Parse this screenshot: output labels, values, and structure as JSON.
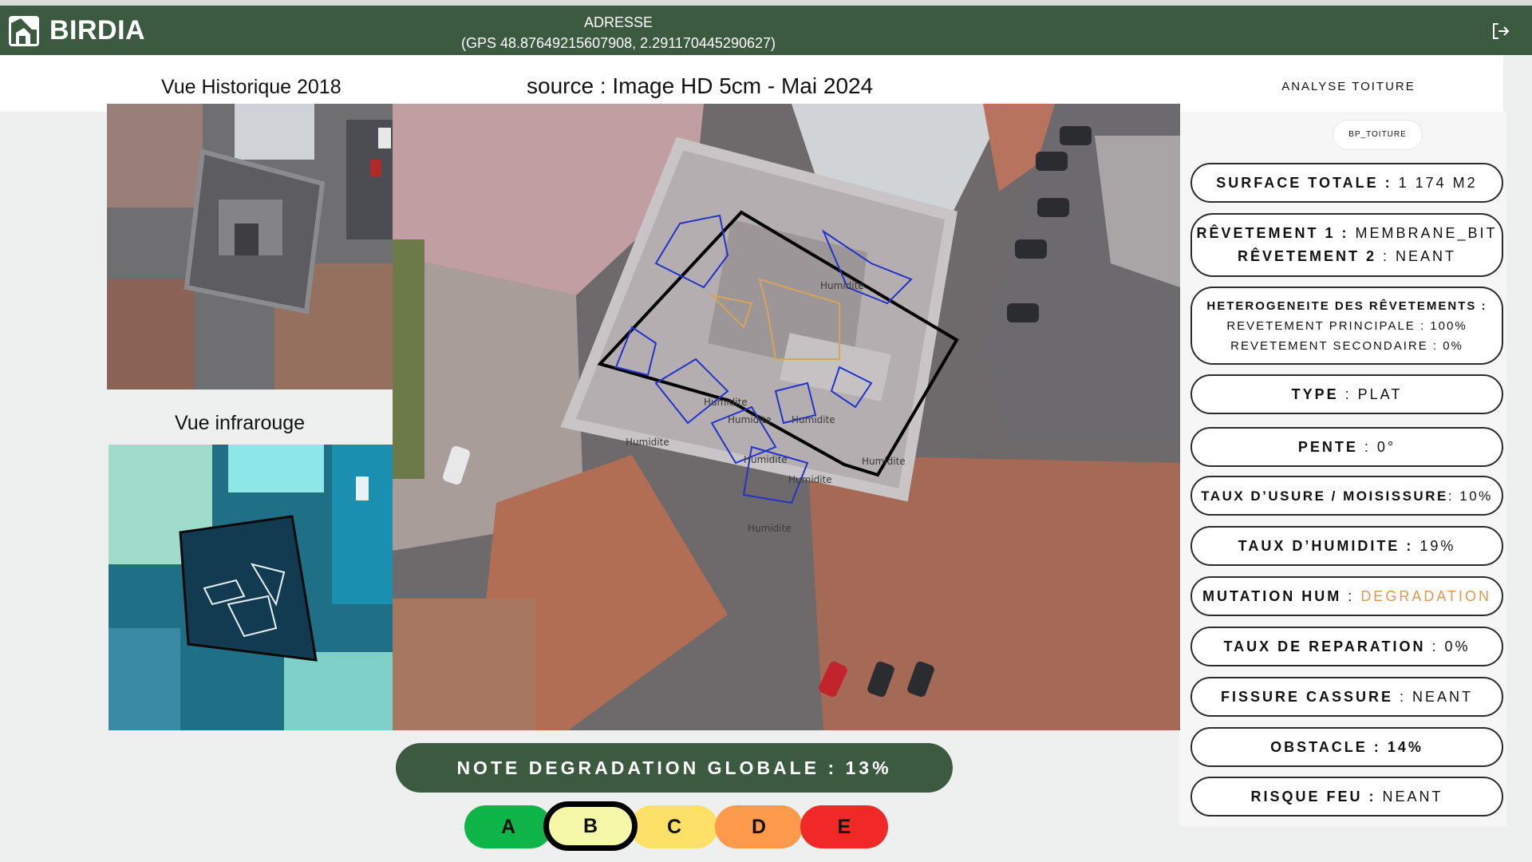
{
  "header": {
    "brand": "BIRDIA",
    "address_label": "ADRESSE",
    "gps": "(GPS 48.87649215607908, 2.291170445290627)",
    "logout_icon": "logout-icon"
  },
  "views": {
    "historic_title": "Vue Historique 2018",
    "infrared_title": "Vue infrarouge",
    "source_title": "source : Image HD 5cm - Mai 2024"
  },
  "map_labels": [
    "Humidite",
    "Humidite",
    "Humidite",
    "Humidite",
    "Humidite",
    "Humidite",
    "Humidite",
    "Humidite",
    "Humidite"
  ],
  "analysis": {
    "title": "ANALYSE TOITURE",
    "chip": "BP_TOITURE",
    "items": [
      {
        "key": "SURFACE TOTALE :",
        "value": " 1 174 M2"
      },
      {
        "key1": "RÊVETEMENT 1 :",
        "value1": " MEMBRANE_BIT",
        "key2": "RÊVETEMENT 2",
        "value2": " : NEANT"
      },
      {
        "key": "HETEROGENEITE DES RÊVETEMENTS :",
        "line2": "REVETEMENT PRINCIPALE : 100%",
        "line3": "REVETEMENT SECONDAIRE : 0%"
      },
      {
        "key": "TYPE",
        "value": " : PLAT"
      },
      {
        "key": "PENTE",
        "value": " : 0°"
      },
      {
        "key": "TAUX D’USURE / MOISISSURE",
        "value": ": 10%"
      },
      {
        "key": "TAUX D’HUMIDITE :",
        "value": " 19%"
      },
      {
        "key": "MUTATION HUM",
        "sep": " : ",
        "value": "DEGRADATION"
      },
      {
        "key": "TAUX DE REPARATION",
        "value": " : 0%"
      },
      {
        "key": "FISSURE CASSURE",
        "value": " : NEANT"
      },
      {
        "key": "OBSTACLE : ",
        "value": "14%"
      },
      {
        "key": "RISQUE FEU :",
        "value": " NEANT"
      }
    ]
  },
  "note": {
    "label": "NOTE DEGRADATION GLOBALE : 13%",
    "grades": [
      {
        "letter": "A",
        "color": "#10b54a"
      },
      {
        "letter": "B",
        "color": "#f4f8a8",
        "selected": true
      },
      {
        "letter": "C",
        "color": "#fde067"
      },
      {
        "letter": "D",
        "color": "#fd9a4c"
      },
      {
        "letter": "E",
        "color": "#f02828"
      }
    ]
  },
  "colors": {
    "header_bg": "#3c5a40",
    "accent_degradation": "#e0964c",
    "humidity_outline": "#2233cc",
    "wear_outline": "#d9a35a"
  }
}
